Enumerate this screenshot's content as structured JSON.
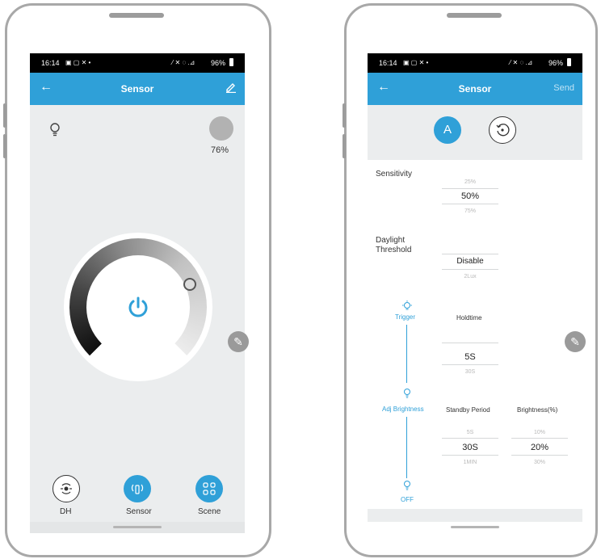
{
  "status_bar": {
    "time": "16:14",
    "left_icons": "▣ ▢ ✕ •",
    "right_icons": "⁄ ✕ ◌ .⊿",
    "battery": "96%"
  },
  "left_screen": {
    "header": {
      "title": "Sensor"
    },
    "brightness_percent": "76%",
    "dial": {
      "level_percent": 76
    },
    "bottom_nav": [
      {
        "label": "DH"
      },
      {
        "label": "Sensor"
      },
      {
        "label": "Scene"
      }
    ]
  },
  "right_screen": {
    "header": {
      "title": "Sensor",
      "send_label": "Send"
    },
    "mode_buttons": {
      "auto_label": "A"
    },
    "sensitivity": {
      "label": "Sensitivity",
      "above": "25%",
      "value": "50%",
      "below": "75%"
    },
    "daylight": {
      "label_line1": "Daylight",
      "label_line2": "Threshold",
      "value": "Disable",
      "below": "2Lux"
    },
    "stages": {
      "trigger": "Trigger",
      "adj_brightness": "Adj Brightness",
      "off": "OFF"
    },
    "holdtime": {
      "label": "Holdtime",
      "value": "5S",
      "below": "30S"
    },
    "standby": {
      "label": "Standby Period",
      "above": "5S",
      "value": "30S",
      "below": "1MIN"
    },
    "brightness": {
      "label": "Brightness(%)",
      "above": "10%",
      "value": "20%",
      "below": "30%"
    }
  }
}
